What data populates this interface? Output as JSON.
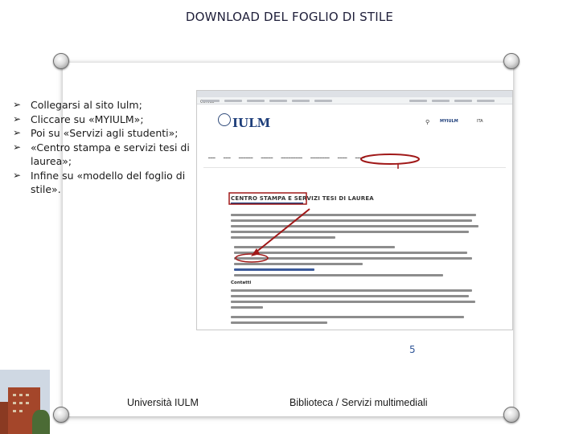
{
  "slide": {
    "title": "DOWNLOAD DEL FOGLIO DI STILE",
    "bullets": [
      "Collegarsi al sito Iulm;",
      "Cliccare su «MYIULM»;",
      "Poi su «Servizi agli studenti»;",
      "«Centro stampa e servizi tesi di laurea»;",
      "Infine su «modello del foglio di stile»."
    ],
    "bullet_icon": "arrow-right-icon",
    "page_number": "5",
    "footer_left": "Università IULM",
    "footer_right": "Biblioteca / Servizi multimediali"
  },
  "screenshot": {
    "tab_label": "Cervus",
    "logo": "IULM",
    "header_myiulm": "MYIULM",
    "header_lang": "ITA",
    "section_title": "CENTRO STAMPA E SERVIZI TESI DI LAUREA",
    "contatti_label": "Contatti",
    "highlight_color": "#a01818"
  }
}
